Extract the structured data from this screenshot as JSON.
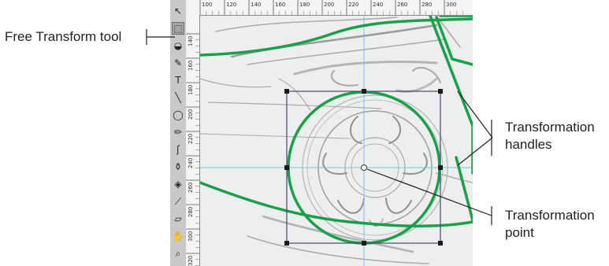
{
  "callouts": {
    "free_transform": "Free Transform tool",
    "handles": [
      "Transformation",
      "handles"
    ],
    "point": [
      "Transformation",
      "point"
    ]
  },
  "ruler": {
    "top": [
      "100",
      "120",
      "140",
      "160",
      "180",
      "200",
      "220",
      "240",
      "260",
      "280",
      "300"
    ],
    "left": [
      "140",
      "160",
      "180",
      "200",
      "220",
      "240",
      "260",
      "280",
      "300",
      "320"
    ]
  },
  "toolbar": {
    "tools": [
      {
        "icon": "subselect-arrow-icon",
        "glyph": "↖"
      },
      {
        "icon": "free-transform-icon",
        "glyph": "⬚",
        "active": true
      },
      {
        "icon": "lasso-icon",
        "glyph": "◒"
      },
      {
        "icon": "pen-icon",
        "glyph": "✎"
      },
      {
        "icon": "text-icon",
        "glyph": "T"
      },
      {
        "icon": "line-icon",
        "glyph": "╲"
      },
      {
        "icon": "oval-icon",
        "glyph": "◯"
      },
      {
        "icon": "pencil-icon",
        "glyph": "✏"
      },
      {
        "icon": "brush-icon",
        "glyph": "ʃ"
      },
      {
        "icon": "ink-bottle-icon",
        "glyph": "⚱"
      },
      {
        "icon": "paint-bucket-icon",
        "glyph": "◈"
      },
      {
        "icon": "eyedropper-icon",
        "glyph": "⟋"
      },
      {
        "icon": "eraser-icon",
        "glyph": "▱"
      },
      {
        "icon": "hand-icon",
        "glyph": "✋"
      },
      {
        "icon": "zoom-icon",
        "glyph": "⌕"
      }
    ]
  },
  "colors": {
    "stroke_green": "#1aa04a",
    "bounding_box": "#4b4470",
    "guide": "#7ec4d8",
    "callout_line": "#231f20"
  }
}
